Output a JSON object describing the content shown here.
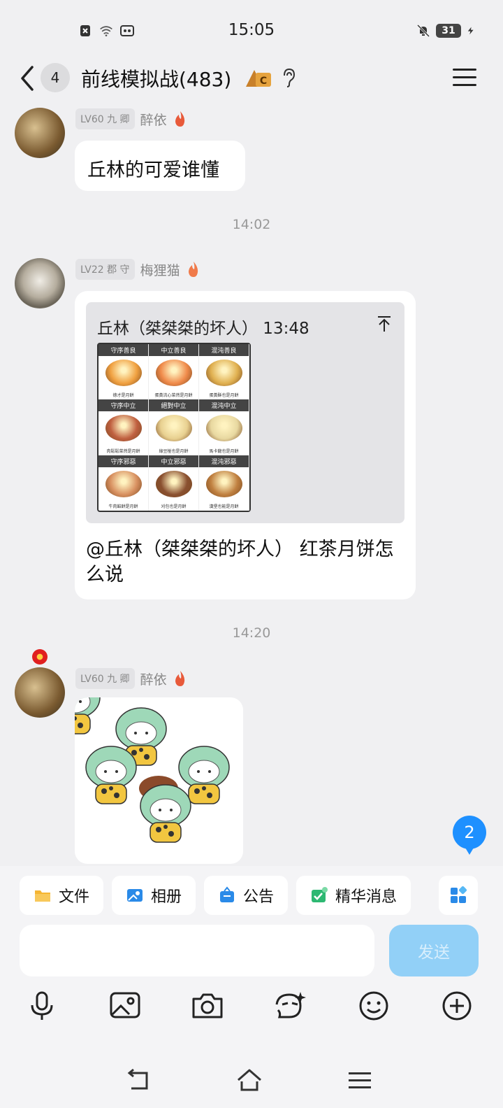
{
  "status_bar": {
    "time": "15:05",
    "battery": "31"
  },
  "header": {
    "unread_count": "4",
    "title": "前线模拟战(483)"
  },
  "messages": [
    {
      "level": "LV60 九 卿",
      "nickname": "醉依",
      "text": "丘林的可爱谁懂"
    },
    {
      "timestamp": "14:02"
    },
    {
      "level": "LV22 郡 守",
      "nickname": "梅狸猫",
      "quote_header": "丘林（桀桀桀的坏人） 13:48",
      "text": "@丘林（桀桀桀的坏人） 红茶月饼怎么说"
    },
    {
      "timestamp": "14:20"
    },
    {
      "level": "LV60 九 卿",
      "nickname": "醉依",
      "sticker": "chibi-green-hair-characters"
    }
  ],
  "meme_grid": {
    "cells": [
      {
        "header": "守序善良",
        "caption": "德才是月餅",
        "color": "#f0a040"
      },
      {
        "header": "中立善良",
        "caption": "蛋黃流心菜然是月餅",
        "color": "#f08a4a"
      },
      {
        "header": "混沌善良",
        "caption": "蛋黃酥也是月餅",
        "color": "#e0b050"
      },
      {
        "header": "守序中立",
        "caption": "肉鬆鬆菜然是月餅",
        "color": "#c06040"
      },
      {
        "header": "絕對中立",
        "caption": "綠豆椪也是月餅",
        "color": "#e8d090"
      },
      {
        "header": "混沌中立",
        "caption": "馬卡龍也是月餅",
        "color": "#e8d8a0"
      },
      {
        "header": "守序邪惡",
        "caption": "牛肉餡餅是月餅",
        "color": "#d89060"
      },
      {
        "header": "中立邪惡",
        "caption": "刈包也是月餅",
        "color": "#8a5030"
      },
      {
        "header": "混沌邪惡",
        "caption": "漢堡也能是月餅",
        "color": "#c08040"
      }
    ]
  },
  "new_message_badge": "2",
  "quick_actions": [
    {
      "label": "文件",
      "icon": "folder-icon",
      "color": "#f5b533"
    },
    {
      "label": "相册",
      "icon": "album-icon",
      "color": "#2a8ae8"
    },
    {
      "label": "公告",
      "icon": "announcement-icon",
      "color": "#2a8ae8"
    },
    {
      "label": "精华消息",
      "icon": "essence-icon",
      "color": "#2db872"
    }
  ],
  "composer": {
    "placeholder": "",
    "send_label": "发送"
  },
  "toolbar_icons": [
    "microphone-icon",
    "image-icon",
    "camera-icon",
    "emoji-face-icon",
    "smiley-icon",
    "plus-icon"
  ],
  "accent": "#1e90ff"
}
